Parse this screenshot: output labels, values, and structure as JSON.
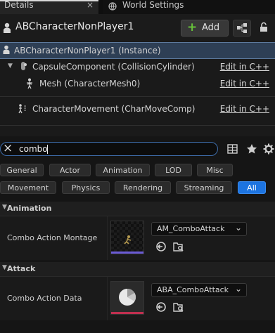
{
  "tabs": {
    "details_label": "Details",
    "world_settings_label": "World Settings",
    "close_glyph": "×"
  },
  "header": {
    "title": "ABCharacterNonPlayer1",
    "add_label": "Add"
  },
  "tree": {
    "instance_label": "ABCharacterNonPlayer1 (Instance)",
    "capsule_label": "CapsuleComponent (CollisionCylinder)",
    "mesh_label": "Mesh (CharacterMesh0)",
    "movement_label": "CharacterMovement (CharMoveComp)",
    "edit_label": "Edit in C++"
  },
  "search": {
    "value": "combo",
    "clear_glyph": "×"
  },
  "filters": [
    "General",
    "Actor",
    "Animation",
    "LOD",
    "Misc",
    "Movement",
    "Physics",
    "Rendering",
    "Streaming",
    "All"
  ],
  "sections": {
    "animation": {
      "title": "Animation",
      "property_label": "Combo Action Montage",
      "value": "AM_ComboAttack"
    },
    "attack": {
      "title": "Attack",
      "property_label": "Combo Action Data",
      "value": "ABA_ComboAttack"
    }
  },
  "colors": {
    "accent_blue": "#1d74e0",
    "selection": "#2e3f55",
    "add_plus": "#67c23a"
  }
}
